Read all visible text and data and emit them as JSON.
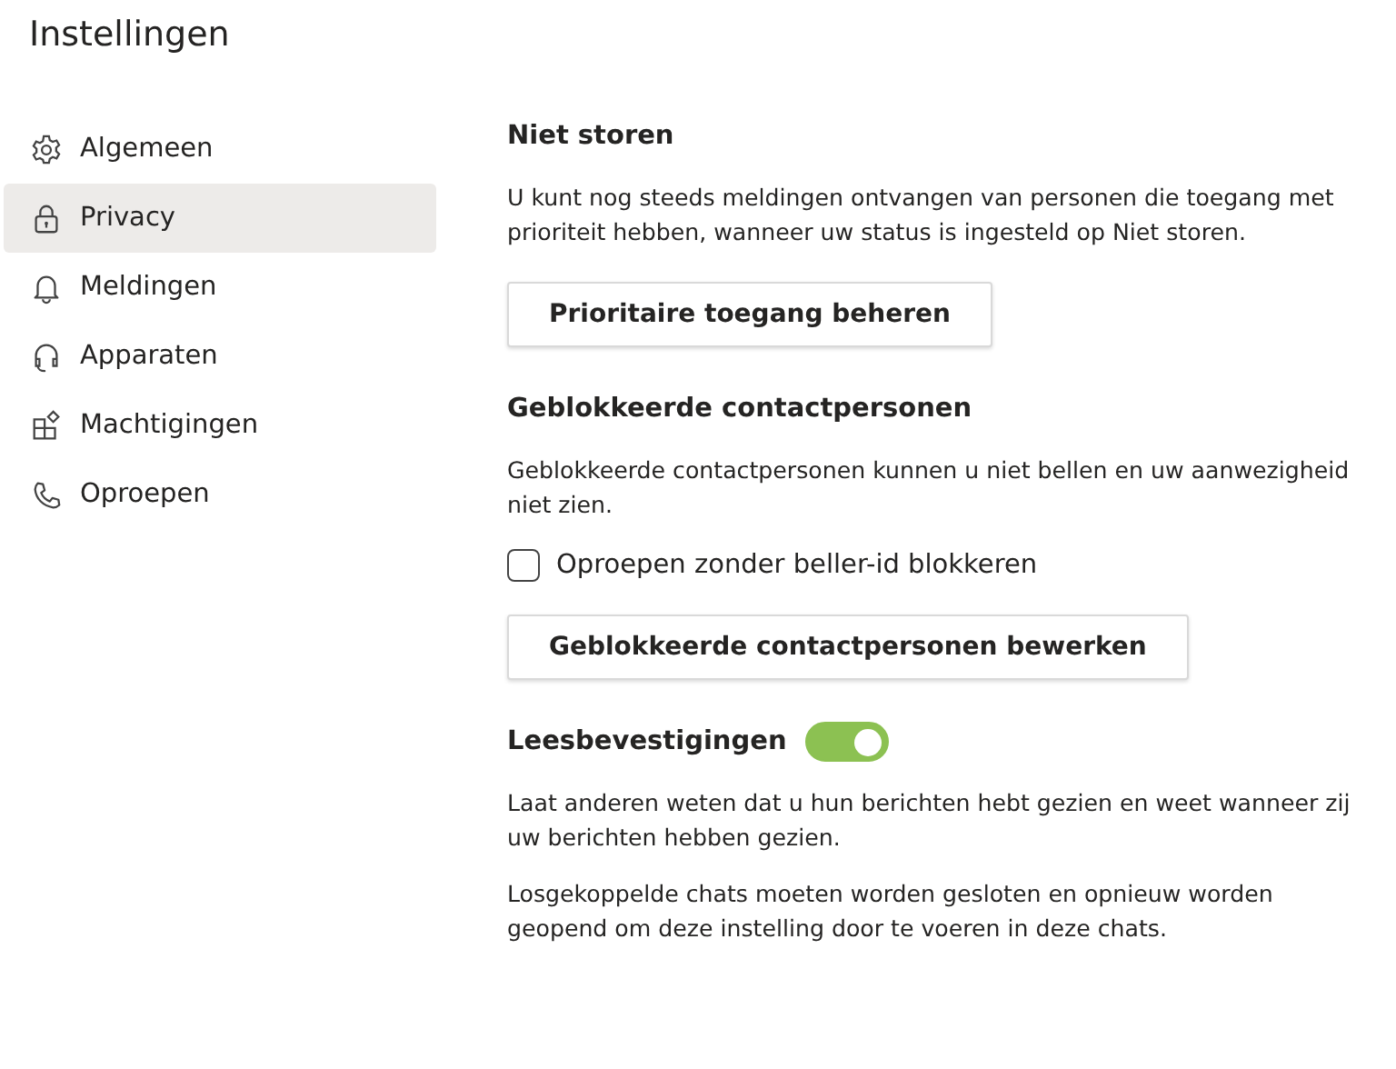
{
  "title": "Instellingen",
  "sidebar": {
    "items": [
      {
        "label": "Algemeen",
        "selected": false
      },
      {
        "label": "Privacy",
        "selected": true
      },
      {
        "label": "Meldingen",
        "selected": false
      },
      {
        "label": "Apparaten",
        "selected": false
      },
      {
        "label": "Machtigingen",
        "selected": false
      },
      {
        "label": "Oproepen",
        "selected": false
      }
    ]
  },
  "sections": [
    {
      "heading": "Niet storen",
      "items": [
        {
          "kind": "paragraph",
          "text": "U kunt nog steeds meldingen ontvangen van personen die toegang met prioriteit hebben, wanneer uw status is ingesteld op Niet storen."
        },
        {
          "kind": "button",
          "text": "Prioritaire toegang beheren"
        }
      ]
    },
    {
      "heading": "Geblokkeerde contactpersonen",
      "items": [
        {
          "kind": "paragraph",
          "text": "Geblokkeerde contactpersonen kunnen u niet bellen en uw aanwezigheid niet zien."
        },
        {
          "kind": "checkbox",
          "text": "Oproepen zonder beller-id blokkeren",
          "checked": false
        },
        {
          "kind": "button",
          "text": "Geblokkeerde contactpersonen bewerken"
        }
      ]
    },
    {
      "heading": "Leesbevestigingen",
      "toggle": {
        "on": true
      },
      "items": [
        {
          "kind": "paragraph",
          "text": "Laat anderen weten dat u hun berichten hebt gezien en weet wanneer zij uw berichten hebben gezien."
        },
        {
          "kind": "paragraph",
          "text": "Losgekoppelde chats moeten worden gesloten en opnieuw worden geopend om deze instelling door te voeren in deze chats."
        }
      ]
    }
  ]
}
